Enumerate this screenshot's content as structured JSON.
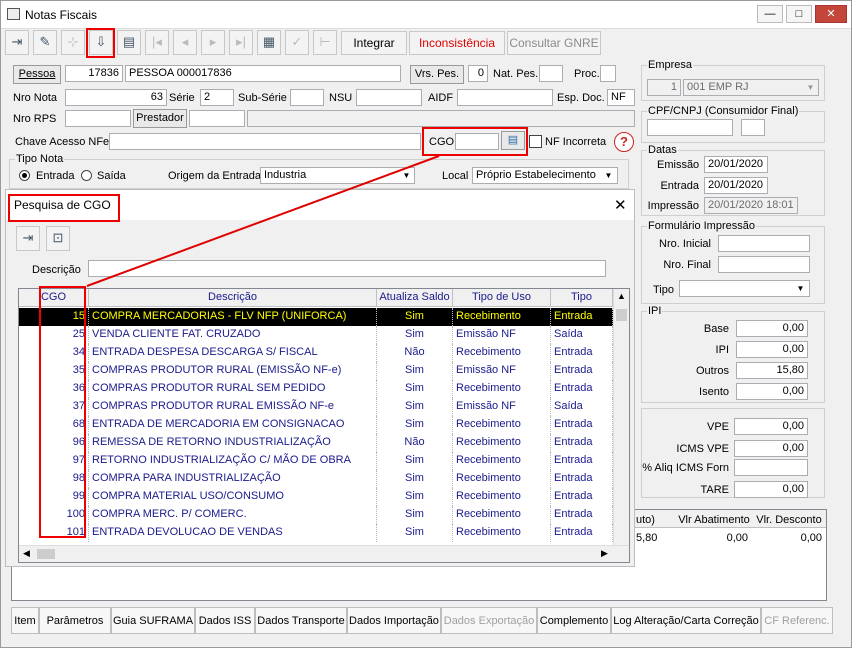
{
  "window": {
    "title": "Notas Fiscais",
    "minimize": "—",
    "maximize": "□",
    "close": "✕"
  },
  "toolbar": {
    "integrar": "Integrar",
    "inconsistencia": "Inconsistência",
    "consultar_gnre": "Consultar GNRE",
    "inconsistencia_color": "#e00000"
  },
  "pessoa": {
    "button": "Pessoa",
    "code": "17836",
    "name": "PESSOA 000017836",
    "vrs_pes_button": "Vrs. Pes.",
    "vrs_pes_value": "0",
    "nat_pes_label": "Nat. Pes.",
    "proc_label": "Proc."
  },
  "nota": {
    "nro_nota_label": "Nro Nota",
    "nro_nota": "63",
    "serie_label": "Série",
    "serie": "2",
    "sub_serie_label": "Sub-Série",
    "nsu_label": "NSU",
    "aidf_label": "AIDF",
    "esp_doc_label": "Esp. Doc.",
    "esp_doc": "NF",
    "nro_rps_label": "Nro RPS",
    "prestador_button": "Prestador",
    "chave_label": "Chave Acesso NFe",
    "cgo_label": "CGO",
    "nf_incorreta_label": "NF Incorreta"
  },
  "tipo_nota": {
    "group": "Tipo Nota",
    "entrada": "Entrada",
    "saida": "Saída",
    "origem_label": "Origem da Entrada",
    "origem_value": "Industria",
    "local_label": "Local",
    "local_value": "Próprio Estabelecimento"
  },
  "empresa": {
    "group": "Empresa",
    "code": "1",
    "name": "001 EMP RJ"
  },
  "cpf": {
    "group": "CPF/CNPJ (Consumidor Final)"
  },
  "datas": {
    "group": "Datas",
    "emissao_label": "Emissão",
    "emissao": "20/01/2020",
    "entrada_label": "Entrada",
    "entrada": "20/01/2020",
    "impressao_label": "Impressão",
    "impressao": "20/01/2020 18:01"
  },
  "formulario": {
    "group": "Formulário Impressão",
    "nro_inicial_label": "Nro. Inicial",
    "nro_final_label": "Nro. Final",
    "tipo_label": "Tipo"
  },
  "ipi": {
    "group": "IPI",
    "base_label": "Base",
    "base": "0,00",
    "ipi_label": "IPI",
    "ipi": "0,00",
    "outros_label": "Outros",
    "outros": "15,80",
    "isento_label": "Isento",
    "isento": "0,00"
  },
  "vpe": {
    "vpe_label": "VPE",
    "vpe": "0,00",
    "icms_vpe_label": "ICMS VPE",
    "icms_vpe": "0,00",
    "aliq_label": "% Aliq ICMS Forn",
    "tare_label": "TARE",
    "tare": "0,00"
  },
  "bottom_grid": {
    "headers": [
      "uto)",
      "Vlr Abatimento",
      "Vlr. Desconto"
    ],
    "row": [
      "5,80",
      "0,00",
      "0,00"
    ]
  },
  "search": {
    "title": "Pesquisa de CGO",
    "descricao_label": "Descrição",
    "headers": [
      "CGO",
      "Descrição",
      "Atualiza Saldo",
      "Tipo de Uso",
      "Tipo"
    ],
    "rows": [
      [
        "15",
        "COMPRA MERCADORIAS - FLV NFP (UNIFORCA)",
        "Sim",
        "Recebimento",
        "Entrada"
      ],
      [
        "25",
        "VENDA CLIENTE FAT. CRUZADO",
        "Sim",
        "Emissão NF",
        "Saída"
      ],
      [
        "34",
        "ENTRADA DESPESA DESCARGA S/ FISCAL",
        "Não",
        "Recebimento",
        "Entrada"
      ],
      [
        "35",
        "COMPRAS PRODUTOR RURAL (EMISSÃO NF-e)",
        "Sim",
        "Emissão NF",
        "Entrada"
      ],
      [
        "36",
        "COMPRAS PRODUTOR RURAL SEM PEDIDO",
        "Sim",
        "Recebimento",
        "Entrada"
      ],
      [
        "37",
        "COMPRAS PRODUTOR RURAL EMISSÃO NF-e",
        "Sim",
        "Emissão NF",
        "Saída"
      ],
      [
        "68",
        "ENTRADA DE MERCADORIA EM CONSIGNACAO",
        "Sim",
        "Recebimento",
        "Entrada"
      ],
      [
        "96",
        "REMESSA DE RETORNO INDUSTRIALIZAÇÃO",
        "Não",
        "Recebimento",
        "Entrada"
      ],
      [
        "97",
        "RETORNO INDUSTRIALIZAÇÃO C/ MÃO DE OBRA",
        "Sim",
        "Recebimento",
        "Entrada"
      ],
      [
        "98",
        "COMPRA PARA INDUSTRIALIZAÇÃO",
        "Sim",
        "Recebimento",
        "Entrada"
      ],
      [
        "99",
        "COMPRA MATERIAL USO/CONSUMO",
        "Sim",
        "Recebimento",
        "Entrada"
      ],
      [
        "100",
        "COMPRA MERC. P/ COMERC.",
        "Sim",
        "Recebimento",
        "Entrada"
      ],
      [
        "101",
        "ENTRADA DEVOLUCAO DE VENDAS",
        "Sim",
        "Recebimento",
        "Entrada"
      ]
    ]
  },
  "tabs": [
    "Item",
    "Parâmetros",
    "Guia SUFRAMA",
    "Dados ISS",
    "Dados Transporte",
    "Dados Importação",
    "Dados Exportação",
    "Complemento",
    "Log Alteração/Carta Correção",
    "CF Referenc."
  ]
}
